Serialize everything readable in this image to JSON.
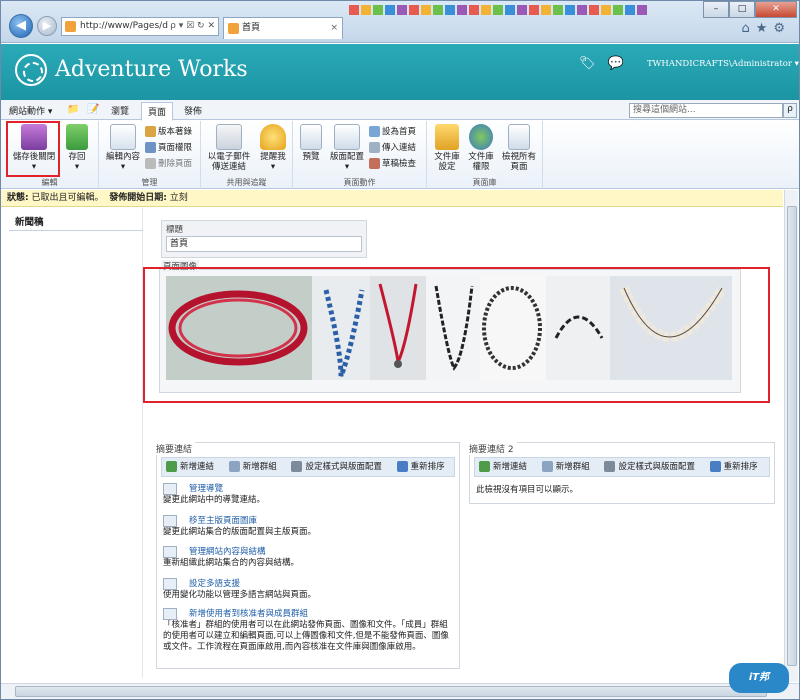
{
  "browser": {
    "address": "http://www/Pages/d",
    "address_tail": "ρ ▾ ☒ ↻ ✕",
    "tab_title": "首頁",
    "tab_close": "×",
    "win_min": "–",
    "win_max": "□",
    "win_close": "✕",
    "tool_icons": "⌂★⚙"
  },
  "header": {
    "site_title": "Adventure Works",
    "user": "TWHANDICRAFTS\\Administrator ▾"
  },
  "ribbon_tabs": {
    "site_actions": "網站動作 ▾",
    "browse": "瀏覽",
    "page": "頁面",
    "publish": "發佈"
  },
  "search": {
    "placeholder": "搜尋這個網站...",
    "button": "ρ"
  },
  "ribbon": {
    "save_close": "儲存後關閉",
    "save": "存回",
    "edit": "編輯內容",
    "version_history": "版本著錄",
    "page_permissions": "頁面權限",
    "delete_page": "刪除頁面",
    "group_edit": "編輯",
    "group_manage": "管理",
    "email_link": "以電子郵件傳送連結",
    "alert_me": "提醒我",
    "group_share": "共用與追蹤",
    "preview": "預覽",
    "page_layout": "版面配置",
    "set_home": "設為首頁",
    "incoming_links": "傳入連結",
    "draft_check": "草稿檢查",
    "group_page_actions": "頁面動作",
    "library_settings": "文件庫設定",
    "library_permissions": "文件庫權限",
    "view_all_pages": "檢視所有頁面",
    "group_library": "頁面庫"
  },
  "status": {
    "label": "狀態:",
    "text": " 已取出且可編輯。",
    "publish_label": "發佈開始日期:",
    "publish_value": " 立刻"
  },
  "leftnav": {
    "heading": "新聞稿"
  },
  "fields": {
    "title_label": "標題",
    "title_value": "首頁",
    "image_label": "頁面圖像"
  },
  "summary1": {
    "header": "摘要連結",
    "new_link": "新增連結",
    "new_group": "新增群組",
    "configure": "設定樣式與版面配置",
    "reorder": "重新排序",
    "items": [
      {
        "title": "管理導覽",
        "desc": "變更此網站中的導覽連結。"
      },
      {
        "title": "移至主版頁面圖庫",
        "desc": "變更此網站集合的版面配置與主版頁面。"
      },
      {
        "title": "管理網站內容與結構",
        "desc": "重新組織此網站集合的內容與結構。"
      },
      {
        "title": "設定多語支援",
        "desc": "使用變化功能以管理多語言網站與頁面。"
      },
      {
        "title": "新增使用者到核准者與成員群組",
        "desc": "「核准者」群組的使用者可以在此網站發佈頁面、圖像和文件。「成員」群組的使用者可以建立和編輯頁面,可以上傳圖像和文件,但是不能發佈頁面、圖像或文件。工作流程在頁面庫啟用,而內容核准在文件庫與圖像庫啟用。"
      }
    ]
  },
  "summary2": {
    "header": "摘要連結 2",
    "new_link": "新增連結",
    "new_group": "新增群組",
    "configure": "設定樣式與版面配置",
    "reorder": "重新排序",
    "empty": "此檢視沒有項目可以顯示。"
  },
  "watermark": "iT邦幫忙",
  "colors": {
    "header_teal": "#1b94a3",
    "highlight_red": "#e0232a",
    "status_yellow": "#fff8c6",
    "link_blue": "#1f5ea8"
  }
}
